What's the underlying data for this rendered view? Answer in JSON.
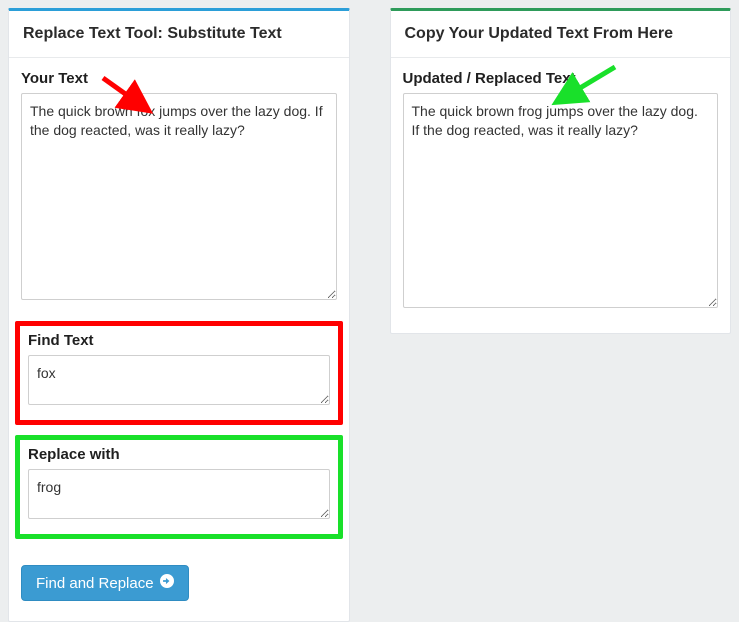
{
  "left": {
    "title": "Replace Text Tool: Substitute Text",
    "your_text": {
      "label": "Your Text",
      "value": "The quick brown fox jumps over the lazy dog. If the dog reacted, was it really lazy?"
    },
    "find": {
      "label": "Find Text",
      "value": "fox"
    },
    "replace": {
      "label": "Replace with",
      "value": "frog"
    },
    "button_label": "Find and Replace"
  },
  "right": {
    "title": "Copy Your Updated Text From Here",
    "output": {
      "label": "Updated / Replaced Text",
      "value": "The quick brown frog jumps over the lazy dog. If the dog reacted, was it really lazy?"
    }
  },
  "annotations": {
    "red_arrow": {
      "color": "#ff0000"
    },
    "green_arrow": {
      "color": "#19e02a"
    },
    "red_box": {
      "color": "#ff0000"
    },
    "green_box": {
      "color": "#19e02a"
    }
  }
}
